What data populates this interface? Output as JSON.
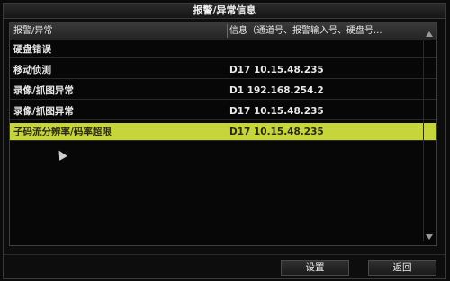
{
  "window": {
    "title": "报警/异常信息"
  },
  "table": {
    "columns": {
      "type": "报警/异常",
      "info": "信息（通道号、报警输入号、硬盘号..."
    },
    "rows": [
      {
        "type": "硬盘错误",
        "info": ""
      },
      {
        "type": "移动侦测",
        "info": "D17  10.15.48.235"
      },
      {
        "type": "录像/抓图异常",
        "info": "D1  192.168.254.2"
      },
      {
        "type": "录像/抓图异常",
        "info": "D17  10.15.48.235"
      },
      {
        "type": "子码流分辨率/码率超限",
        "info": "D17  10.15.48.235",
        "selected": true
      }
    ]
  },
  "footer": {
    "settings_label": "设置",
    "back_label": "返回"
  },
  "colors": {
    "selected_row": "#c6d63a",
    "background": "#0b0b0b"
  }
}
